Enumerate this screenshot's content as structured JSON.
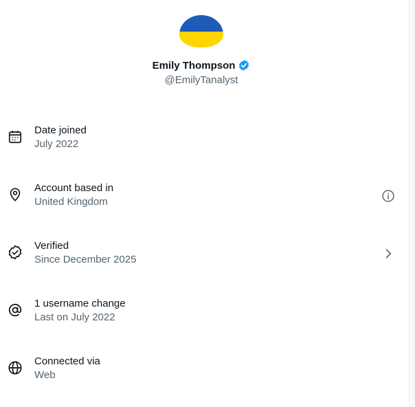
{
  "profile": {
    "display_name": "Emily Thompson",
    "handle": "@EmilyTanalyst",
    "avatar_colors": [
      "#1f5bb8",
      "#ffd500"
    ],
    "verified_badge_color": "#1d9bf0"
  },
  "rows": [
    {
      "icon": "calendar-icon",
      "title": "Date joined",
      "subtitle": "July 2022",
      "action": null
    },
    {
      "icon": "location-pin-icon",
      "title": "Account based in",
      "subtitle": "United Kingdom",
      "action": "info-icon"
    },
    {
      "icon": "verified-check-icon",
      "title": "Verified",
      "subtitle": "Since December 2025",
      "action": "chevron-right-icon"
    },
    {
      "icon": "at-sign-icon",
      "title": "1 username change",
      "subtitle": "Last on July 2022",
      "action": null
    },
    {
      "icon": "globe-icon",
      "title": "Connected via",
      "subtitle": "Web",
      "action": null
    }
  ]
}
